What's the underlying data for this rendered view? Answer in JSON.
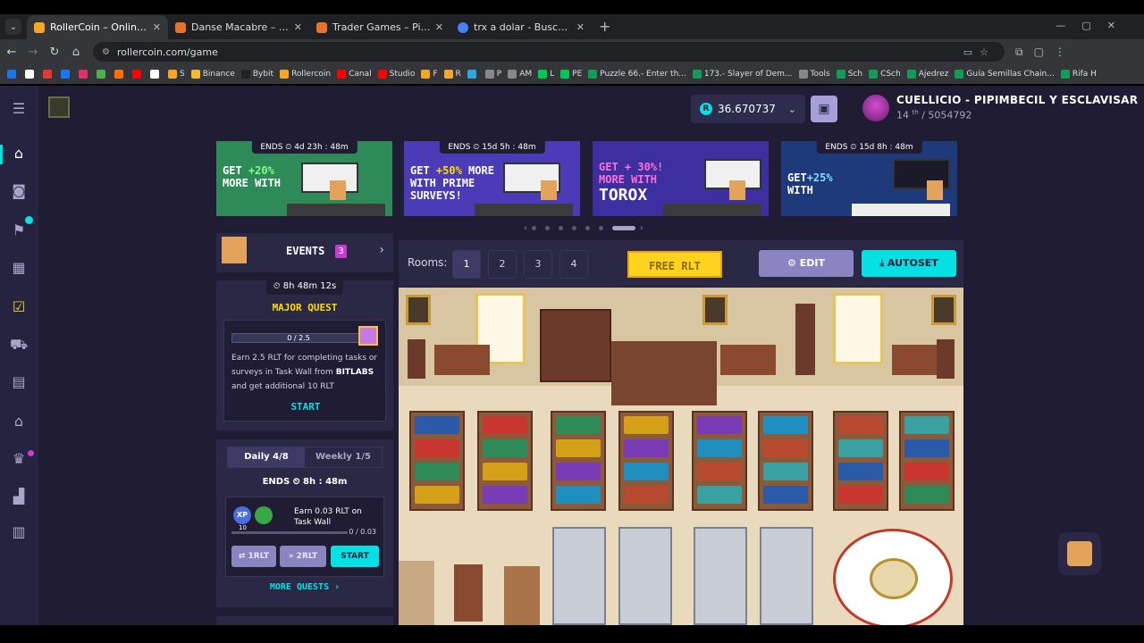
{
  "browser": {
    "tabs": [
      {
        "title": "RollerCoin – Online Bitcoin Mi",
        "color": "#f5a623",
        "active": true
      },
      {
        "title": "Danse Macabre – Piero",
        "color": "#e8732c",
        "active": false
      },
      {
        "title": "Trader Games – Piero",
        "color": "#e8732c",
        "active": false
      },
      {
        "title": "trx a dolar - Buscar con Google",
        "color": "#4285f4",
        "active": false
      }
    ],
    "url": "rollercoin.com/game",
    "bookmarks": [
      {
        "label": "",
        "color": "#1a73e8"
      },
      {
        "label": "",
        "color": "#fff"
      },
      {
        "label": "",
        "color": "#e53935"
      },
      {
        "label": "",
        "color": "#1877f2"
      },
      {
        "label": "",
        "color": "#e1306c"
      },
      {
        "label": "",
        "color": "#4caf50"
      },
      {
        "label": "",
        "color": "#ff6f00"
      },
      {
        "label": "",
        "color": "#ff0000"
      },
      {
        "label": "",
        "color": "#fff"
      },
      {
        "label": "S",
        "color": "#f5a623"
      },
      {
        "label": "Binance",
        "color": "#f3ba2f"
      },
      {
        "label": "Bybit",
        "color": "#222"
      },
      {
        "label": "Rollercoin",
        "color": "#f5a623"
      },
      {
        "label": "Canal",
        "color": "#ff0000"
      },
      {
        "label": "Studio",
        "color": "#ff0000"
      },
      {
        "label": "F",
        "color": "#f5a623"
      },
      {
        "label": "R",
        "color": "#f5a623"
      },
      {
        "label": "",
        "color": "#2ca5e0"
      },
      {
        "label": "P",
        "color": "#888"
      },
      {
        "label": "AM",
        "color": "#888"
      },
      {
        "label": "L",
        "color": "#00c853"
      },
      {
        "label": "PE",
        "color": "#00c853"
      },
      {
        "label": "Puzzle 66.- Enter th...",
        "color": "#0f9d58"
      },
      {
        "label": "173.- Slayer of Dem...",
        "color": "#0f9d58"
      },
      {
        "label": "Tools",
        "color": "#888"
      },
      {
        "label": "Sch",
        "color": "#0f9d58"
      },
      {
        "label": "CSch",
        "color": "#0f9d58"
      },
      {
        "label": "Ajedrez",
        "color": "#0f9d58"
      },
      {
        "label": "Guía Semillas Chain...",
        "color": "#0f9d58"
      },
      {
        "label": "Rifa H",
        "color": "#0f9d58"
      }
    ]
  },
  "header": {
    "balance": "36.670737",
    "currency_icon": "R",
    "username": "CUELLICIO - PIPIMBECIL Y ESCLAVISAR",
    "rank_num": "14",
    "rank_suffix": "th",
    "rank_total": "/ 5054792"
  },
  "banners": [
    {
      "ends": "4d 23h : 48m",
      "text": "GET +20%\nMORE WITH",
      "bg": "#2f8a5a",
      "text_color": "#ffffff"
    },
    {
      "ends": "15d 5h : 48m",
      "text": "GET +50% MORE\nWITH PRIME\nSURVEYS!",
      "bg": "#4b3bb6",
      "text_color": "#ffffff"
    },
    {
      "ends": "",
      "text": "GET + 30%!\nMORE WITH\nTOROX",
      "bg": "#3d2fa0",
      "text_color": "#ffffff"
    },
    {
      "ends": "15d 8h : 48m",
      "text": "GET+25%\nWITH",
      "bg": "#1f3a7a",
      "text_color": "#ffffff"
    }
  ],
  "ends_label": "ENDS",
  "events": {
    "label": "EVENTS",
    "count": "3"
  },
  "major_quest": {
    "timer": "8h 48m 12s",
    "title": "MAJOR QUEST",
    "progress_text": "0 / 2.5",
    "progress": 0,
    "desc_1": "Earn 2.5 RLT for completing tasks or surveys in Task Wall from ",
    "desc_bold": "BITLABS",
    "desc_2": " and get additional 10 RLT",
    "start": "START"
  },
  "quests": {
    "tab_daily": "Daily  4/8",
    "tab_weekly": "Weekly  1/5",
    "ends": "8h : 48m",
    "xp": "XP",
    "xp_value": "10",
    "task": "Earn 0.03 RLT on Task Wall",
    "progress_text": "0 / 0.03",
    "progress": 0,
    "btn_1": "⇄ 1RLT",
    "btn_2": "» 2RLT",
    "btn_start": "START",
    "more": "MORE QUESTS"
  },
  "rooms": {
    "label": "Rooms:",
    "items": [
      "1",
      "2",
      "3",
      "4"
    ],
    "active": "1",
    "free_rlt": "FREE RLT",
    "edit": "EDIT",
    "autoset": "AUTOSET"
  },
  "icons": {
    "sidebar": [
      "menu-icon",
      "home-icon",
      "gamepad-icon",
      "badge-icon",
      "marketplace-icon",
      "calendar-check-icon",
      "cart-icon",
      "store-icon",
      "building-icon",
      "trophy-icon",
      "stairs-icon",
      "news-icon"
    ]
  },
  "colors": {
    "accent": "#03e1e4",
    "bg": "#1f1c33",
    "panel": "#2b2846",
    "gold": "#ffd21f",
    "purple": "#8a84c0",
    "badge": "#c83bd1"
  }
}
